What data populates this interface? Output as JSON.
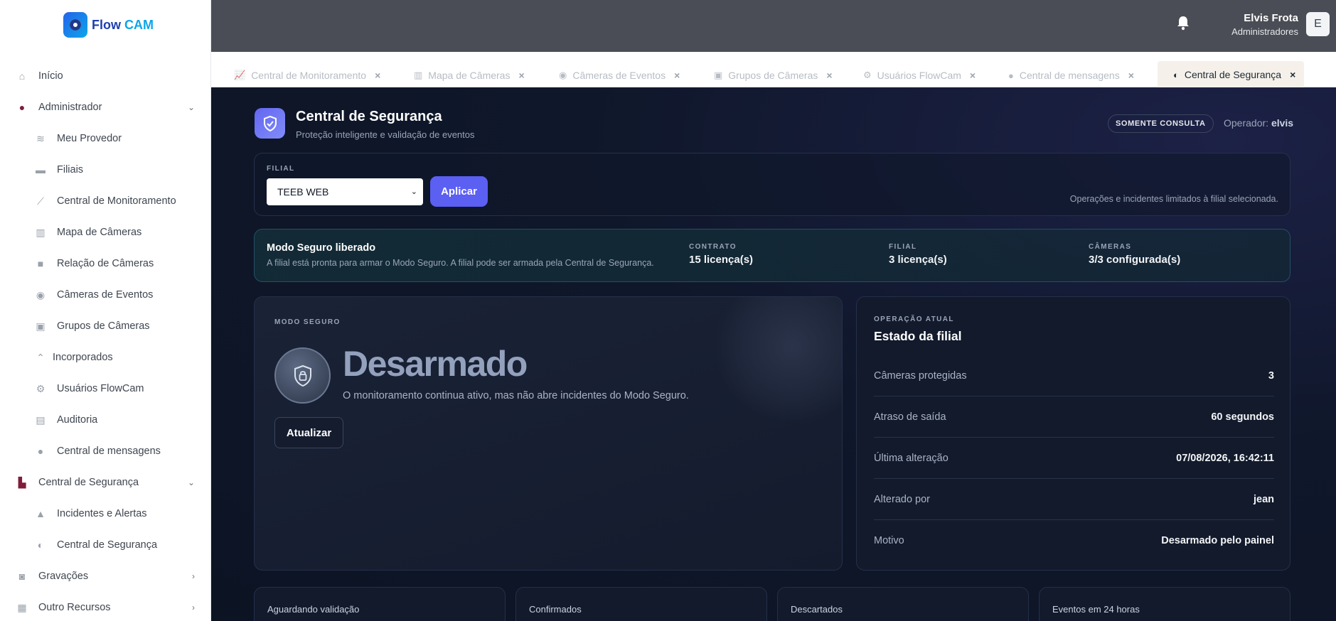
{
  "brand": {
    "name_a": "Flow",
    "name_b": "CAM"
  },
  "sidebar": {
    "items": [
      {
        "label": "Início",
        "icon": "home-icon"
      },
      {
        "label": "Administrador",
        "icon": "user-circle-icon"
      },
      {
        "label": "Meu Provedor",
        "icon": "wifi-icon"
      },
      {
        "label": "Filiais",
        "icon": "store-icon"
      },
      {
        "label": "Central de Monitoramento",
        "icon": "chart-line-icon"
      },
      {
        "label": "Mapa de Câmeras",
        "icon": "map-icon"
      },
      {
        "label": "Relação de Câmeras",
        "icon": "video-icon"
      },
      {
        "label": "Câmeras de Eventos",
        "icon": "eye-icon"
      },
      {
        "label": "Grupos de Câmeras",
        "icon": "group-icon"
      },
      {
        "label": "Incorporados",
        "icon": "angles-up-icon"
      },
      {
        "label": "Usuários FlowCam",
        "icon": "users-cog-icon"
      },
      {
        "label": "Auditoria",
        "icon": "archive-icon"
      },
      {
        "label": "Central de mensagens",
        "icon": "chat-icon"
      },
      {
        "label": "Central de Segurança",
        "icon": "building-shield-icon"
      },
      {
        "label": "Incidentes e Alertas",
        "icon": "warning-icon"
      },
      {
        "label": "Central de Segurança",
        "icon": "shield-icon"
      },
      {
        "label": "Gravações",
        "icon": "camera-icon"
      },
      {
        "label": "Outro Recursos",
        "icon": "grid-icon"
      }
    ]
  },
  "header": {
    "user_name": "Elvis Frota",
    "user_role": "Administradores",
    "avatar_letter": "E"
  },
  "tabs": [
    {
      "label": "Central de Monitoramento",
      "glyph": "📈"
    },
    {
      "label": "Mapa de Câmeras",
      "glyph": "▥"
    },
    {
      "label": "Câmeras de Eventos",
      "glyph": "◉"
    },
    {
      "label": "Grupos de Câmeras",
      "glyph": "▣"
    },
    {
      "label": "Usuários FlowCam",
      "glyph": "⚙"
    },
    {
      "label": "Central de mensagens",
      "glyph": "●"
    },
    {
      "label": "Central de Segurança",
      "glyph": "◐",
      "active": true
    }
  ],
  "page": {
    "title": "Central de Segurança",
    "subtitle": "Proteção inteligente e validação de eventos",
    "badge": "SOMENTE CONSULTA",
    "operator_label": "Operador:",
    "operator_name": "elvis"
  },
  "filial": {
    "label": "FILIAL",
    "selected": "TEEB WEB",
    "apply_label": "Aplicar",
    "note": "Operações e incidentes limitados à filial selecionada."
  },
  "status": {
    "title": "Modo Seguro liberado",
    "subtitle": "A filial está pronta para armar o Modo Seguro. A filial pode ser armada pela Central de Segurança.",
    "stats": [
      {
        "label": "CONTRATO",
        "value": "15 licença(s)"
      },
      {
        "label": "FILIAL",
        "value": "3 licença(s)"
      },
      {
        "label": "CÂMERAS",
        "value": "3/3 configurada(s)"
      }
    ]
  },
  "mode": {
    "label": "MODO SEGURO",
    "state": "Desarmado",
    "description": "O monitoramento continua ativo, mas não abre incidentes do Modo Seguro.",
    "update_label": "Atualizar"
  },
  "operation": {
    "eyebrow": "OPERAÇÃO ATUAL",
    "title": "Estado da filial",
    "rows": [
      {
        "key": "Câmeras protegidas",
        "value": "3"
      },
      {
        "key": "Atraso de saída",
        "value": "60 segundos"
      },
      {
        "key": "Última alteração",
        "value": "07/08/2026, 16:42:11"
      },
      {
        "key": "Alterado por",
        "value": "jean"
      },
      {
        "key": "Motivo",
        "value": "Desarmado pelo painel"
      }
    ]
  },
  "summary_cards": [
    {
      "label": "Aguardando validação"
    },
    {
      "label": "Confirmados"
    },
    {
      "label": "Descartados"
    },
    {
      "label": "Eventos em 24 horas"
    }
  ],
  "colors": {
    "accent": "#5b5ff2",
    "sidebar_bg": "#ffffff",
    "topbar_bg": "#4a4d55",
    "main_bg": "#0f172a",
    "brand_red": "#7f1d3a"
  }
}
